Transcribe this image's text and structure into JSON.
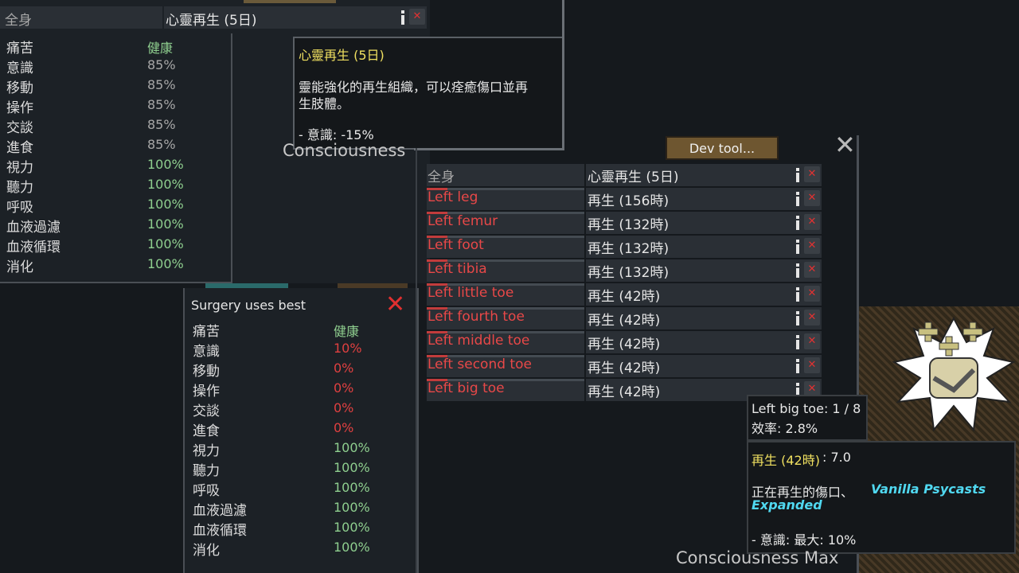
{
  "top_panel": {
    "part": "全身",
    "condition": "心靈再生 (5日)"
  },
  "stats_left": [
    {
      "name": "痛苦",
      "value": "健康",
      "color": "green"
    },
    {
      "name": "意識",
      "value": "85%",
      "color": "gray"
    },
    {
      "name": "移動",
      "value": "85%",
      "color": "gray"
    },
    {
      "name": "操作",
      "value": "85%",
      "color": "gray"
    },
    {
      "name": "交談",
      "value": "85%",
      "color": "gray"
    },
    {
      "name": "進食",
      "value": "85%",
      "color": "gray"
    },
    {
      "name": "視力",
      "value": "100%",
      "color": "green"
    },
    {
      "name": "聽力",
      "value": "100%",
      "color": "green"
    },
    {
      "name": "呼吸",
      "value": "100%",
      "color": "green"
    },
    {
      "name": "血液過濾",
      "value": "100%",
      "color": "green"
    },
    {
      "name": "血液循環",
      "value": "100%",
      "color": "green"
    },
    {
      "name": "消化",
      "value": "100%",
      "color": "green"
    }
  ],
  "tooltip_regen": {
    "title": "心靈再生 (5日)",
    "desc_line1": "靈能強化的再生組織，可以痊癒傷口並再",
    "desc_line2": "生肢體。",
    "effect": " - 意識: -15%"
  },
  "consciousness_label": "Consciousness",
  "surgery_panel": {
    "title": "Surgery uses best",
    "stats": [
      {
        "name": "痛苦",
        "value": "健康",
        "color": "green"
      },
      {
        "name": "意識",
        "value": "10%",
        "color": "red"
      },
      {
        "name": "移動",
        "value": "0%",
        "color": "red"
      },
      {
        "name": "操作",
        "value": "0%",
        "color": "red"
      },
      {
        "name": "交談",
        "value": "0%",
        "color": "red"
      },
      {
        "name": "進食",
        "value": "0%",
        "color": "red"
      },
      {
        "name": "視力",
        "value": "100%",
        "color": "green"
      },
      {
        "name": "聽力",
        "value": "100%",
        "color": "green"
      },
      {
        "name": "呼吸",
        "value": "100%",
        "color": "green"
      },
      {
        "name": "血液過濾",
        "value": "100%",
        "color": "green"
      },
      {
        "name": "血液循環",
        "value": "100%",
        "color": "green"
      },
      {
        "name": "消化",
        "value": "100%",
        "color": "green"
      }
    ]
  },
  "dev_tool_label": "Dev tool...",
  "health_panel": {
    "rows": [
      {
        "part": "全身",
        "condition": "心靈再生 (5日)"
      },
      {
        "part": "Left leg",
        "condition": "再生 (156時)"
      },
      {
        "part": "Left femur",
        "condition": "再生 (132時)"
      },
      {
        "part": "Left foot",
        "condition": "再生 (132時)"
      },
      {
        "part": "Left tibia",
        "condition": "再生 (132時)"
      },
      {
        "part": "Left little toe",
        "condition": "再生 (42時)"
      },
      {
        "part": "Left fourth toe",
        "condition": "再生 (42時)"
      },
      {
        "part": "Left middle toe",
        "condition": "再生 (42時)"
      },
      {
        "part": "Left second toe",
        "condition": "再生 (42時)"
      },
      {
        "part": "Left big toe",
        "condition": "再生 (42時)"
      }
    ]
  },
  "tooltip_part": {
    "line1": "Left big toe:  1 / 8",
    "line2": "效率: 2.8%"
  },
  "tooltip_hediff": {
    "title_colored": "再生 (42時)",
    "title_rest": ": 7.0",
    "desc": "正在再生的傷口、",
    "mod_line1": "Vanilla Psycasts",
    "mod_line2": "Expanded",
    "effect": " - 意識: 最大:   10%"
  },
  "consciousness_max_label": "Consciousness Max",
  "colors": {
    "green": "#8fcf8f",
    "gray": "#a8a8a8",
    "red": "#e04040",
    "yellow": "#f0e060",
    "cyan": "#50d8f0"
  }
}
